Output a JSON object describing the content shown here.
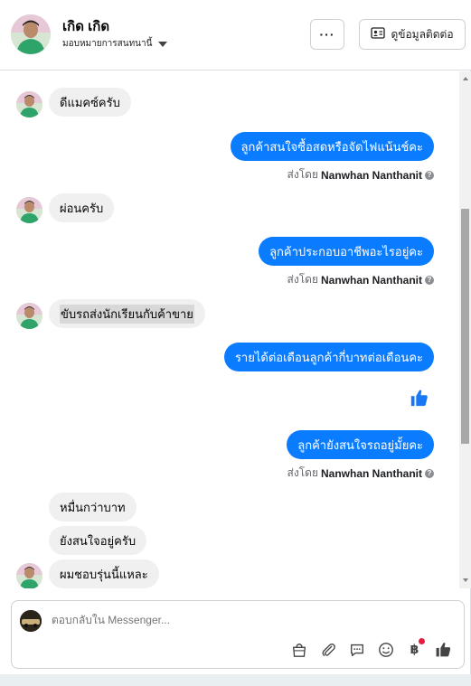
{
  "header": {
    "name": "เกิด เกิด",
    "assign_label": "มอบหมายการสนทนานี้",
    "more_label": "···",
    "contact_label": "ดูข้อมูลติดต่อ"
  },
  "messages": [
    {
      "dir": "in",
      "text": "ดีแมคซ์ครับ"
    },
    {
      "dir": "out",
      "text": "ลูกค้าสนใจซื้อสดหรือจัดไฟแน้นช์คะ"
    },
    {
      "dir": "in",
      "text": "ผ่อนครับ"
    },
    {
      "dir": "out",
      "text": "ลูกค้าประกอบอาชีพอะไรอยู่คะ"
    },
    {
      "dir": "in",
      "text": "ขับรถส่งนักเรียนกับค้าขาย"
    },
    {
      "dir": "out",
      "text": "รายได้ต่อเดือนลูกค้ากี่บาทต่อเดือนคะ"
    },
    {
      "dir": "out",
      "text": "ลูกค้ายังสนใจรถอยู่มั้ยคะ"
    },
    {
      "dir": "in",
      "text": "หมื่นกว่าบาท"
    },
    {
      "dir": "in",
      "text": "ยังสนใจอยู่ครับ"
    },
    {
      "dir": "in",
      "text": "ผมชอบรุ่นนี้แหละ"
    }
  ],
  "sent_by": {
    "prefix": "ส่งโดย",
    "agent": "Nanwhan Nanthanit",
    "info_icon": "?"
  },
  "composer": {
    "placeholder": "ตอบกลับใน Messenger...",
    "baht_symbol": "฿"
  },
  "icons": {
    "more": "more-dots-icon",
    "contact": "contact-card-icon",
    "like": "thumbs-up-icon",
    "bag": "shopping-bag-icon",
    "attach": "paperclip-icon",
    "chat": "chat-bubble-icon",
    "emoji": "emoji-icon",
    "payment": "baht-icon"
  },
  "colors": {
    "outgoing": "#0a7cff",
    "incoming": "#f0f0f0",
    "like": "#1877f2",
    "notify_dot": "#e41e3f"
  }
}
